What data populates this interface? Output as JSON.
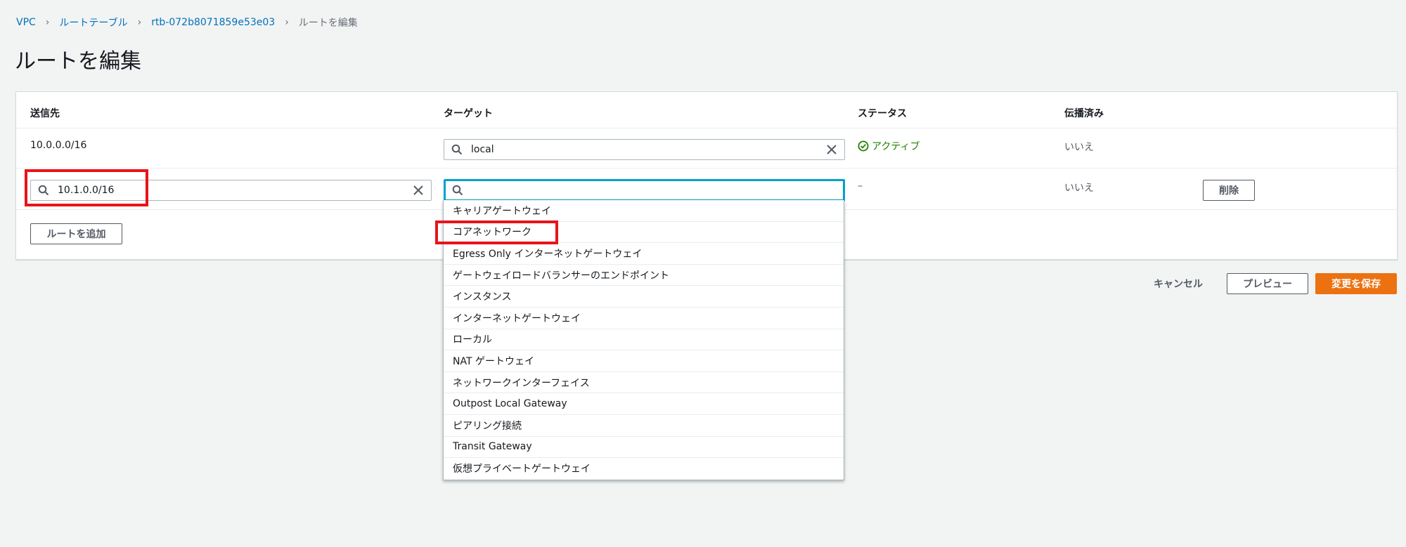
{
  "breadcrumb": {
    "items": [
      "VPC",
      "ルートテーブル",
      "rtb-072b8071859e53e03"
    ],
    "current": "ルートを編集",
    "separator": ">"
  },
  "page": {
    "title": "ルートを編集"
  },
  "table": {
    "headers": {
      "destination": "送信先",
      "target": "ターゲット",
      "status": "ステータス",
      "propagated": "伝播済み"
    },
    "rows": [
      {
        "destination": "10.0.0.0/16",
        "target_value": "local",
        "status": "アクティブ",
        "propagated": "いいえ"
      },
      {
        "destination_value": "10.1.0.0/16",
        "target_value": "",
        "status": "–",
        "propagated": "いいえ",
        "remove_label": "削除"
      }
    ],
    "add_route_label": "ルートを追加"
  },
  "dropdown": {
    "options": [
      "キャリアゲートウェイ",
      "コアネットワーク",
      "Egress Only インターネットゲートウェイ",
      "ゲートウェイロードバランサーのエンドポイント",
      "インスタンス",
      "インターネットゲートウェイ",
      "ローカル",
      "NAT ゲートウェイ",
      "ネットワークインターフェイス",
      "Outpost Local Gateway",
      "ピアリング接続",
      "Transit Gateway",
      "仮想プライベートゲートウェイ"
    ]
  },
  "actions": {
    "cancel": "キャンセル",
    "preview": "プレビュー",
    "save": "変更を保存"
  },
  "colors": {
    "link": "#0073bb",
    "primary": "#ec7211",
    "success": "#1d8102",
    "focus": "#00a1c9",
    "highlight": "#e8141a"
  }
}
